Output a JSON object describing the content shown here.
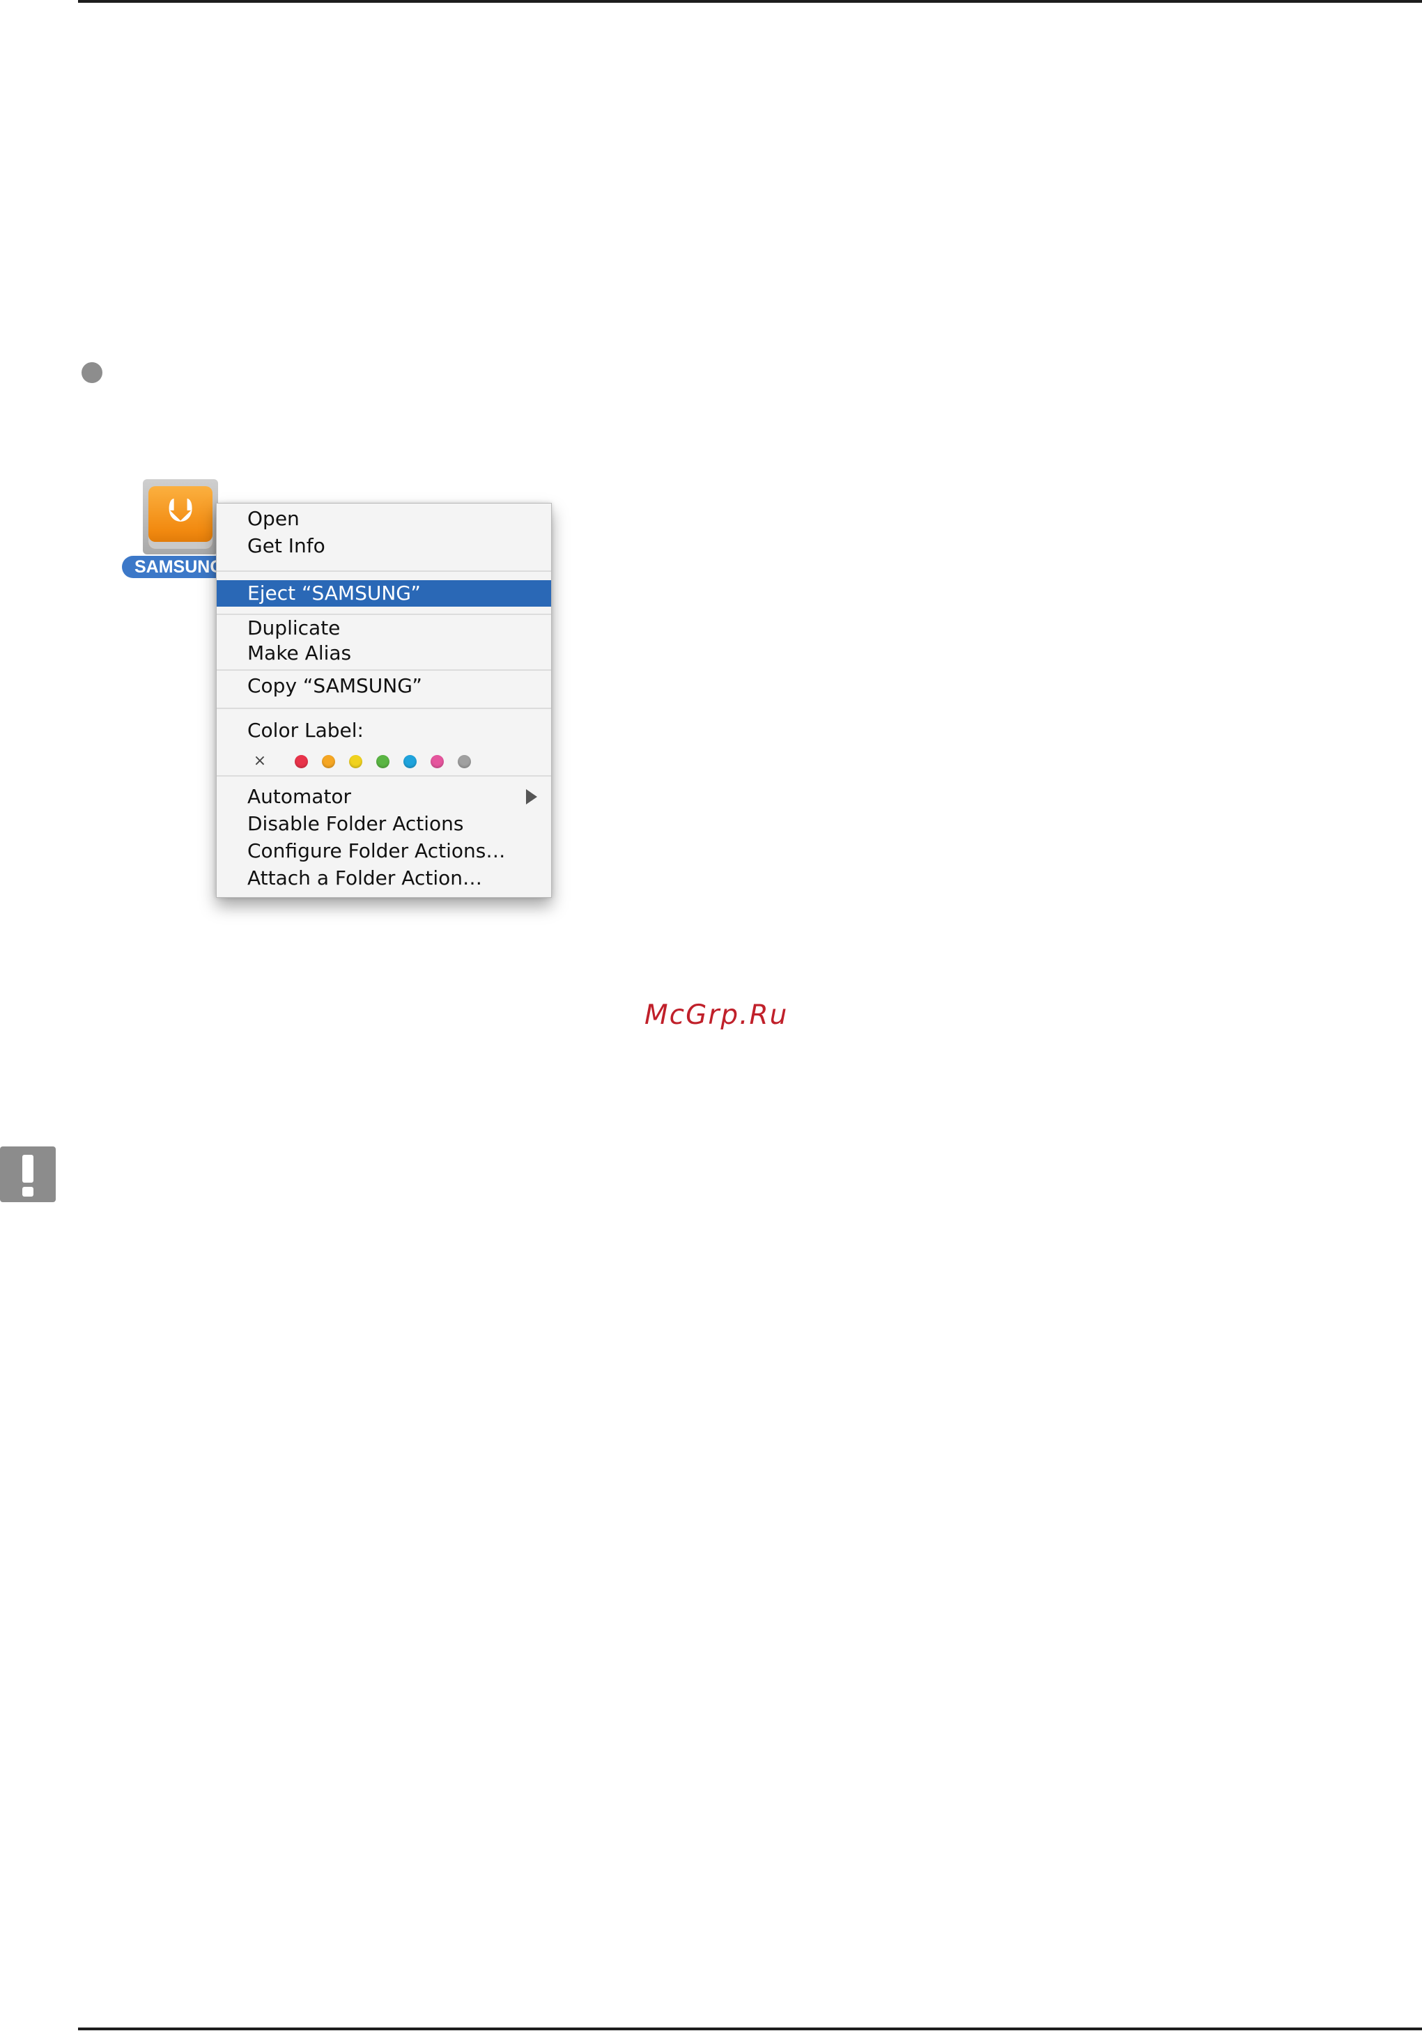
{
  "drive": {
    "label": "SAMSUNG",
    "icon": "usb-drive-icon"
  },
  "menu": {
    "items": [
      {
        "label": "Open"
      },
      {
        "label": "Get Info"
      },
      {
        "label": "Eject “SAMSUNG”",
        "highlighted": true
      },
      {
        "label": "Duplicate"
      },
      {
        "label": "Make Alias"
      },
      {
        "label": "Copy “SAMSUNG”"
      },
      {
        "label": "Color Label:"
      },
      {
        "label": "Automator",
        "submenu": true
      },
      {
        "label": "Disable Folder Actions"
      },
      {
        "label": "Configure Folder Actions…"
      },
      {
        "label": "Attach a Folder Action…"
      }
    ],
    "color_labels": {
      "none_glyph": "×",
      "colors": [
        "#e8334a",
        "#f5a623",
        "#f0d21e",
        "#5ab543",
        "#1fa3dc",
        "#e5559d",
        "#a0a0a0"
      ]
    },
    "highlight_color": "#2a68b6"
  },
  "watermark": "McGrp.Ru",
  "warning_icon": "exclamation-icon"
}
